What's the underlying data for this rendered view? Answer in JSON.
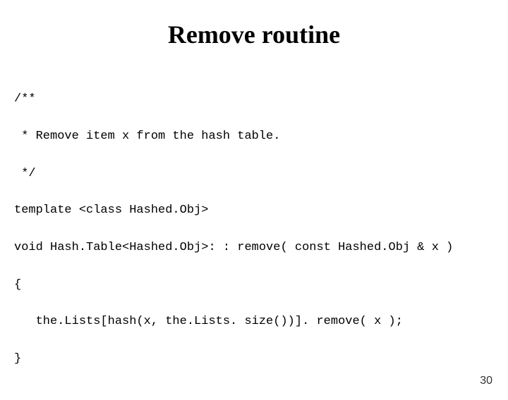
{
  "title": "Remove routine",
  "code": {
    "l1": "/**",
    "l2": " * Remove item x from the hash table.",
    "l3": " */",
    "l4": "template <class Hashed.Obj>",
    "l5": "void Hash.Table<Hashed.Obj>: : remove( const Hashed.Obj & x )",
    "l6": "{",
    "l7": "   the.Lists[hash(x, the.Lists. size())]. remove( x );",
    "l8": "}"
  },
  "page_number": "30"
}
